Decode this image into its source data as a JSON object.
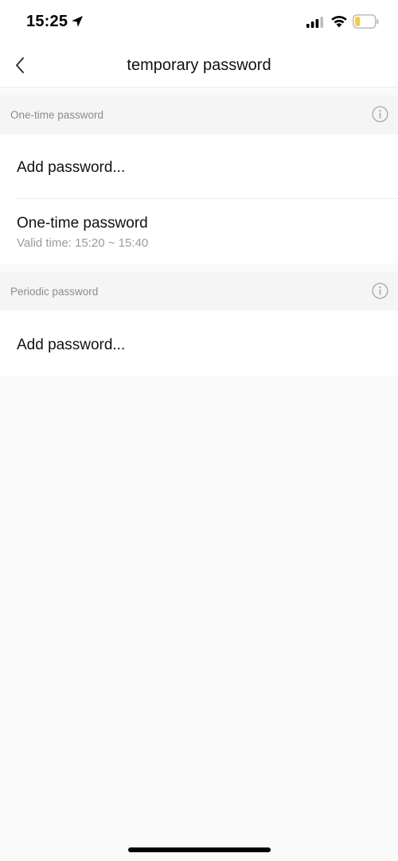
{
  "status_bar": {
    "time": "15:25"
  },
  "nav": {
    "title": "temporary password"
  },
  "sections": [
    {
      "header": "One-time password",
      "rows": [
        {
          "title": "Add password..."
        },
        {
          "title": "One-time password",
          "subtitle": "Valid time: 15:20 ~ 15:40"
        }
      ]
    },
    {
      "header": "Periodic password",
      "rows": [
        {
          "title": "Add password..."
        }
      ]
    }
  ],
  "colors": {
    "background": "#fafafa",
    "section_header_bg": "#f5f5f5",
    "secondary_text": "#9a9a9a",
    "battery_low": "#f2c94c"
  }
}
